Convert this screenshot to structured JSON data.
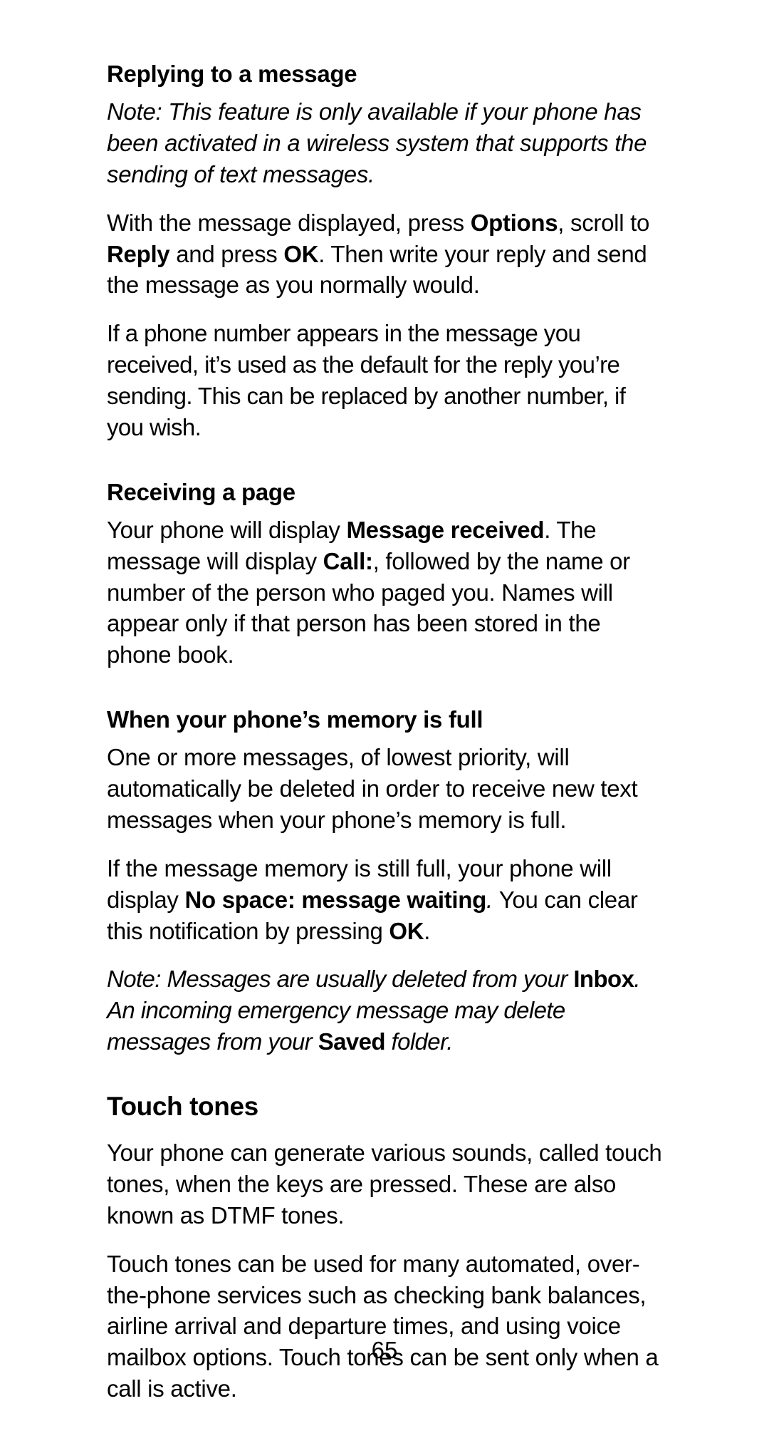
{
  "page_number": "65",
  "sections": {
    "replying": {
      "heading": "Replying to a message",
      "note1_a": "Note: This feature is only available if your phone has been activated in a wireless system that supports the sending of text messages.",
      "p1_a": "With the message displayed, press ",
      "p1_b": "Options",
      "p1_c": ", scroll to ",
      "p1_d": "Reply",
      "p1_e": " and press ",
      "p1_f": "OK",
      "p1_g": ". Then write your reply and send the message as you normally would.",
      "p2": "If a phone number appears in the message you received, it’s used as the default for the reply you’re sending. This can be replaced by another number, if you wish."
    },
    "receiving": {
      "heading": "Receiving a page",
      "p1_a": "Your phone will display ",
      "p1_b": "Message received",
      "p1_c": ". The message will display ",
      "p1_d": "Call:",
      "p1_e": ", followed by the name or number of the person who paged you. Names will appear only if that person has been stored in the phone book."
    },
    "memory": {
      "heading": "When your phone’s memory is full",
      "p1": "One or more messages, of lowest priority, will automatically be deleted in order to receive new text messages when your phone’s memory is full.",
      "p2_a": "If the message memory is still full, your phone will display ",
      "p2_b": "No space: message waiting",
      "p2_c": ". ",
      "p2_d": "You can clear this notification by pressing ",
      "p2_e": "OK",
      "p2_f": ".",
      "note_a": "Note: Messages are usually deleted from your ",
      "note_b": "Inbox",
      "note_c": ". An incoming emergency message may delete messages from your ",
      "note_d": "Saved",
      "note_e": " folder."
    },
    "touch": {
      "heading": "Touch tones",
      "p1": "Your phone can generate various sounds, called touch tones, when the keys are pressed. These are also known as DTMF tones.",
      "p2": "Touch tones can be used for many automated, over-the-phone services such as checking bank balances, airline arrival and departure times, and using voice mailbox options. Touch tones can be sent only when a call is active."
    }
  }
}
